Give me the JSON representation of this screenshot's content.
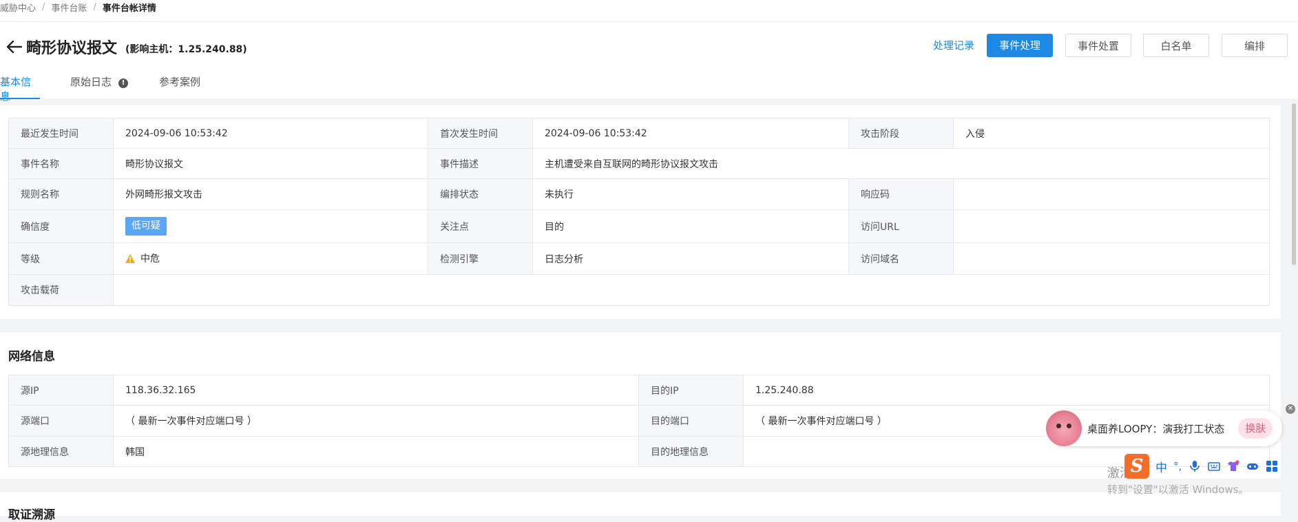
{
  "breadcrumb": [
    "威胁中心",
    "事件台账",
    "事件台帐详情"
  ],
  "breadcrumb_sep": "/",
  "header": {
    "title": "畸形协议报文",
    "subtitle": "(影响主机：1.25.240.88)",
    "link_action": "处理记录",
    "primary_action": "事件处理",
    "actions": [
      "事件处置",
      "白名单",
      "编排"
    ]
  },
  "tabs": [
    {
      "label": "基本信息",
      "active": true
    },
    {
      "label": "原始日志",
      "badge": "!"
    },
    {
      "label": "参考案例"
    }
  ],
  "basic_info": {
    "rows": [
      [
        "最近发生时间",
        "2024-09-06 10:53:42",
        "首次发生时间",
        "2024-09-06 10:53:42",
        "攻击阶段",
        "入侵"
      ],
      [
        "事件名称",
        "畸形协议报文",
        "事件描述",
        "主机遭受来自互联网的畸形协议报文攻击"
      ],
      [
        "规则名称",
        "外网畸形报文攻击",
        "编排状态",
        "未执行",
        "响应码",
        ""
      ],
      [
        "确信度",
        "低可疑",
        "关注点",
        "目的",
        "访问URL",
        ""
      ],
      [
        "等级",
        "中危",
        "检测引擎",
        "日志分析",
        "访问域名",
        ""
      ],
      [
        "攻击载荷",
        ""
      ]
    ]
  },
  "network_info": {
    "title": "网络信息",
    "rows": [
      [
        "源IP",
        "118.36.32.165",
        "目的IP",
        "1.25.240.88"
      ],
      [
        "源端口",
        "（ 最新一次事件对应端口号 ）",
        "目的端口",
        "（ 最新一次事件对应端口号 ）"
      ],
      [
        "源地理信息",
        "韩国",
        "目的地理信息",
        ""
      ]
    ]
  },
  "next_section_title": "取证溯源",
  "colors": {
    "accent": "#1e88e5",
    "tag": "#5aa6f5",
    "warning": "#f5a623"
  },
  "overlay": {
    "loopy_text": "桌面养LOOPY：演我打工状态",
    "loopy_button": "换肤",
    "ime_logo": "S",
    "ime_mode": "中",
    "ime_punct": "°,",
    "watermark_line1": "激活",
    "watermark_line2": "转到\"设置\"以激活 Windows。"
  }
}
